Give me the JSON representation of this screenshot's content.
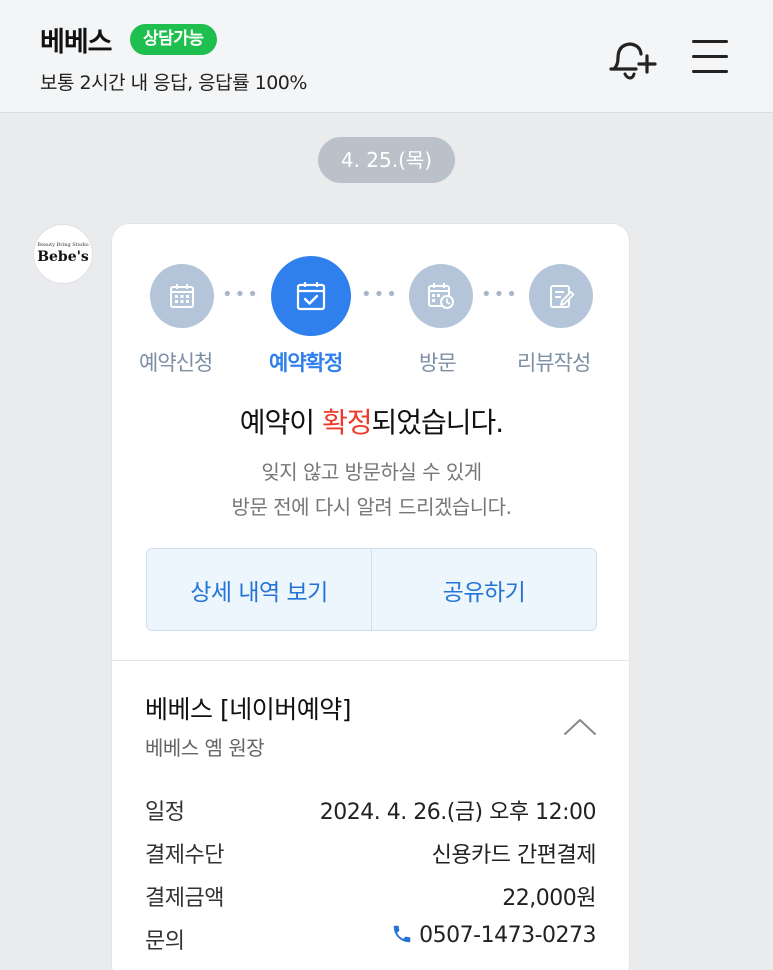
{
  "header": {
    "shop_name": "베베스",
    "status_badge": "상담가능",
    "response_info": "보통 2시간 내 응답, 응답률 100%",
    "bell_icon": "bell-plus-icon",
    "menu_icon": "hamburger-menu-icon"
  },
  "chat": {
    "date": "4. 25.(목)",
    "avatar": {
      "tagline": "Beauty Bring Studio",
      "brand": "Bebe's"
    }
  },
  "steps": [
    {
      "label": "예약신청",
      "icon": "calendar-grid-icon",
      "active": false
    },
    {
      "label": "예약확정",
      "icon": "calendar-check-icon",
      "active": true
    },
    {
      "label": "방문",
      "icon": "calendar-clock-icon",
      "active": false
    },
    {
      "label": "리뷰작성",
      "icon": "review-edit-icon",
      "active": false
    }
  ],
  "confirmation": {
    "title_prefix": "예약이 ",
    "title_highlight": "확정",
    "title_suffix": "되었습니다.",
    "line1": "잊지 않고 방문하실 수 있게",
    "line2": "방문 전에 다시 알려 드리겠습니다."
  },
  "actions": {
    "details": "상세 내역 보기",
    "share": "공유하기"
  },
  "booking": {
    "title": "베베스 [네이버예약]",
    "subtitle": "베베스 옘 원장",
    "rows": [
      {
        "label": "일정",
        "value": "2024. 4. 26.(금) 오후 12:00"
      },
      {
        "label": "결제수단",
        "value": "신용카드 간편결제"
      },
      {
        "label": "결제금액",
        "value": "22,000원"
      },
      {
        "label": "문의",
        "value": "0507-1473-0273"
      }
    ]
  },
  "colors": {
    "accent": "#2f80ed",
    "highlight": "#ee3b2b",
    "badge": "#1fbf4f",
    "step_inactive": "#b5c5d9"
  }
}
